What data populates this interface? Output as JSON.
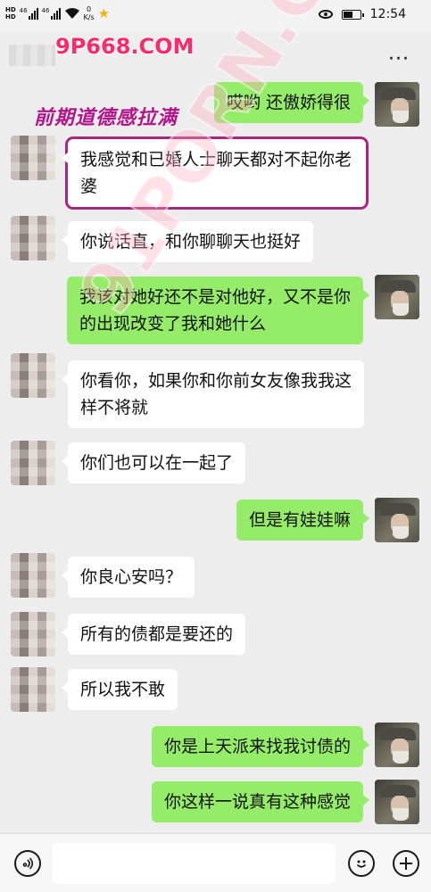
{
  "status_bar": {
    "hd1": "HD",
    "hd2": "HD",
    "net1": "46",
    "net2": "46",
    "speed_value": "0",
    "speed_unit": "K/s",
    "time": "12:54"
  },
  "header": {
    "watermark": "9P668.COM",
    "more": "···"
  },
  "overlay_caption": "前期道德感拉满",
  "diagonal_watermark": "91PORN.COM",
  "messages": [
    {
      "side": "out",
      "text": "哎哟 还傲娇得很"
    },
    {
      "side": "in",
      "text": "我感觉和已婚人士聊天都对不起你老婆",
      "highlighted": true
    },
    {
      "side": "in",
      "text": "你说话直，和你聊聊天也挺好"
    },
    {
      "side": "out",
      "text": "我该对她好还不是对他好，又不是你的出现改变了我和她什么"
    },
    {
      "side": "in",
      "text": "你看你，如果你和你前女友像我我这样不将就"
    },
    {
      "side": "in",
      "text": "你们也可以在一起了"
    },
    {
      "side": "out",
      "text": "但是有娃娃嘛"
    },
    {
      "side": "in",
      "text": "你良心安吗？"
    },
    {
      "side": "in",
      "text": "所有的债都是要还的"
    },
    {
      "side": "in",
      "text": "所以我不敢"
    },
    {
      "side": "out",
      "text": "你是上天派来找我讨债的"
    },
    {
      "side": "out",
      "text": "你这样一说真有这种感觉"
    }
  ],
  "icons": {
    "voice": "voice-icon",
    "emoji": "emoji-icon",
    "add": "plus-icon"
  },
  "colors": {
    "outgoing_bubble": "#95ec69",
    "incoming_bubble": "#ffffff",
    "background": "#ededed",
    "caption": "#b1178a",
    "highlight_border": "#a9267e"
  }
}
